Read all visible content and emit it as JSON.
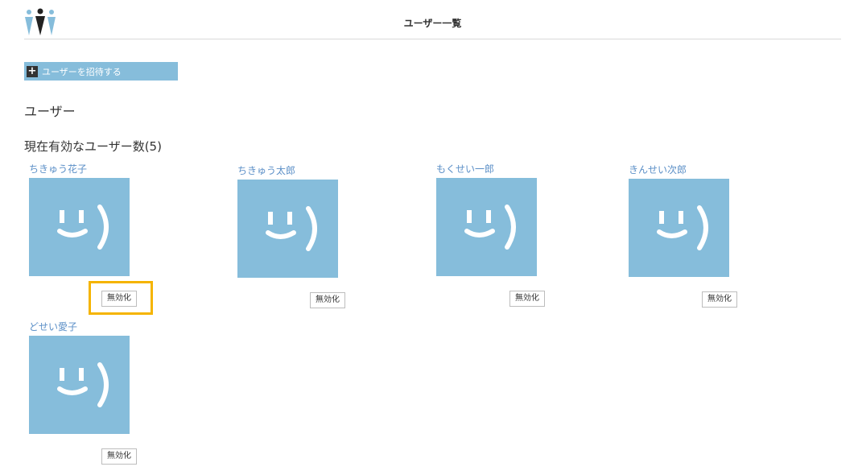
{
  "header": {
    "title": "ユーザー一覧"
  },
  "invite_button": {
    "icon_label": "+",
    "label": "ユーザーを招待する"
  },
  "section_title": "ユーザー",
  "active_count_title": "現在有効なユーザー数(5)",
  "colors": {
    "accent": "#86bddb",
    "link": "#5b8fc7",
    "highlight": "#f5b400"
  },
  "users": [
    {
      "name": "ちきゅう花子",
      "button_label": "無効化"
    },
    {
      "name": "ちきゅう太郎",
      "button_label": "無効化"
    },
    {
      "name": "もくせい一郎",
      "button_label": "無効化"
    },
    {
      "name": "きんせい次郎",
      "button_label": "無効化"
    },
    {
      "name": "どせい愛子",
      "button_label": "無効化"
    }
  ]
}
